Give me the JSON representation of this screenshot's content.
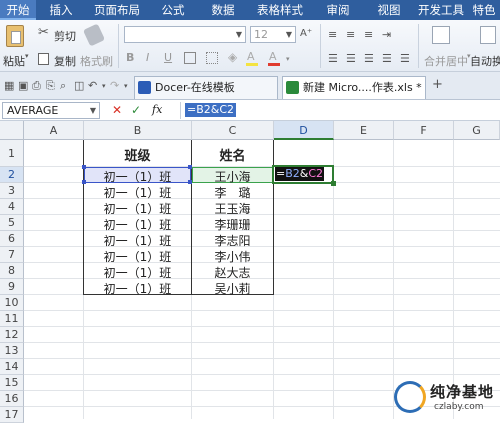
{
  "menu": [
    "开始",
    "插入",
    "页面布局",
    "公式",
    "数据",
    "表格样式",
    "审阅",
    "视图",
    "开发工具",
    "特色"
  ],
  "ribbon": {
    "paste": "粘贴",
    "cut": "剪切",
    "copy": "复制",
    "format_painter": "格式刷",
    "font_size": "12",
    "merge_center": "合并居中",
    "wrap_text": "自动换行",
    "bold": "B",
    "italic": "I",
    "underline": "U",
    "font_color": "A",
    "highlight": "A"
  },
  "tabs": {
    "docer": "Docer-在线模板",
    "file": "新建 Micro....作表.xls *",
    "add": "+"
  },
  "formula_bar": {
    "name_box": "AVERAGE",
    "cancel": "✕",
    "accept": "✓",
    "fx": "fx",
    "formula": "=B2&C2"
  },
  "columns": [
    "A",
    "B",
    "C",
    "D",
    "E",
    "F",
    "G"
  ],
  "rows": [
    "1",
    "2",
    "3",
    "4",
    "5",
    "6",
    "7",
    "8",
    "9",
    "10",
    "11",
    "12",
    "13",
    "14",
    "15",
    "16",
    "17"
  ],
  "table": {
    "header_class": "班级",
    "header_name": "姓名",
    "classes": [
      "初一（1）班",
      "初一（1）班",
      "初一（1）班",
      "初一（1）班",
      "初一（1）班",
      "初一（1）班",
      "初一（1）班",
      "初一（1）班"
    ],
    "names": [
      "王小海",
      "李　璐",
      "王玉海",
      "李珊珊",
      "李志阳",
      "李小伟",
      "赵大志",
      "吴小莉"
    ]
  },
  "active_cell": {
    "text_prefix": "=",
    "ref1": "B2",
    "amp": "&",
    "ref2": "C2"
  },
  "watermark": {
    "name": "纯净基地",
    "url": "czlaby.com"
  },
  "colors": {
    "menu_bg": "#2f5e9e",
    "selection_blue": "#3a55c8",
    "selection_green": "#2e7d32",
    "ref_blue_text": "#8fb0ff",
    "ref_pink_text": "#ff7ad9"
  }
}
